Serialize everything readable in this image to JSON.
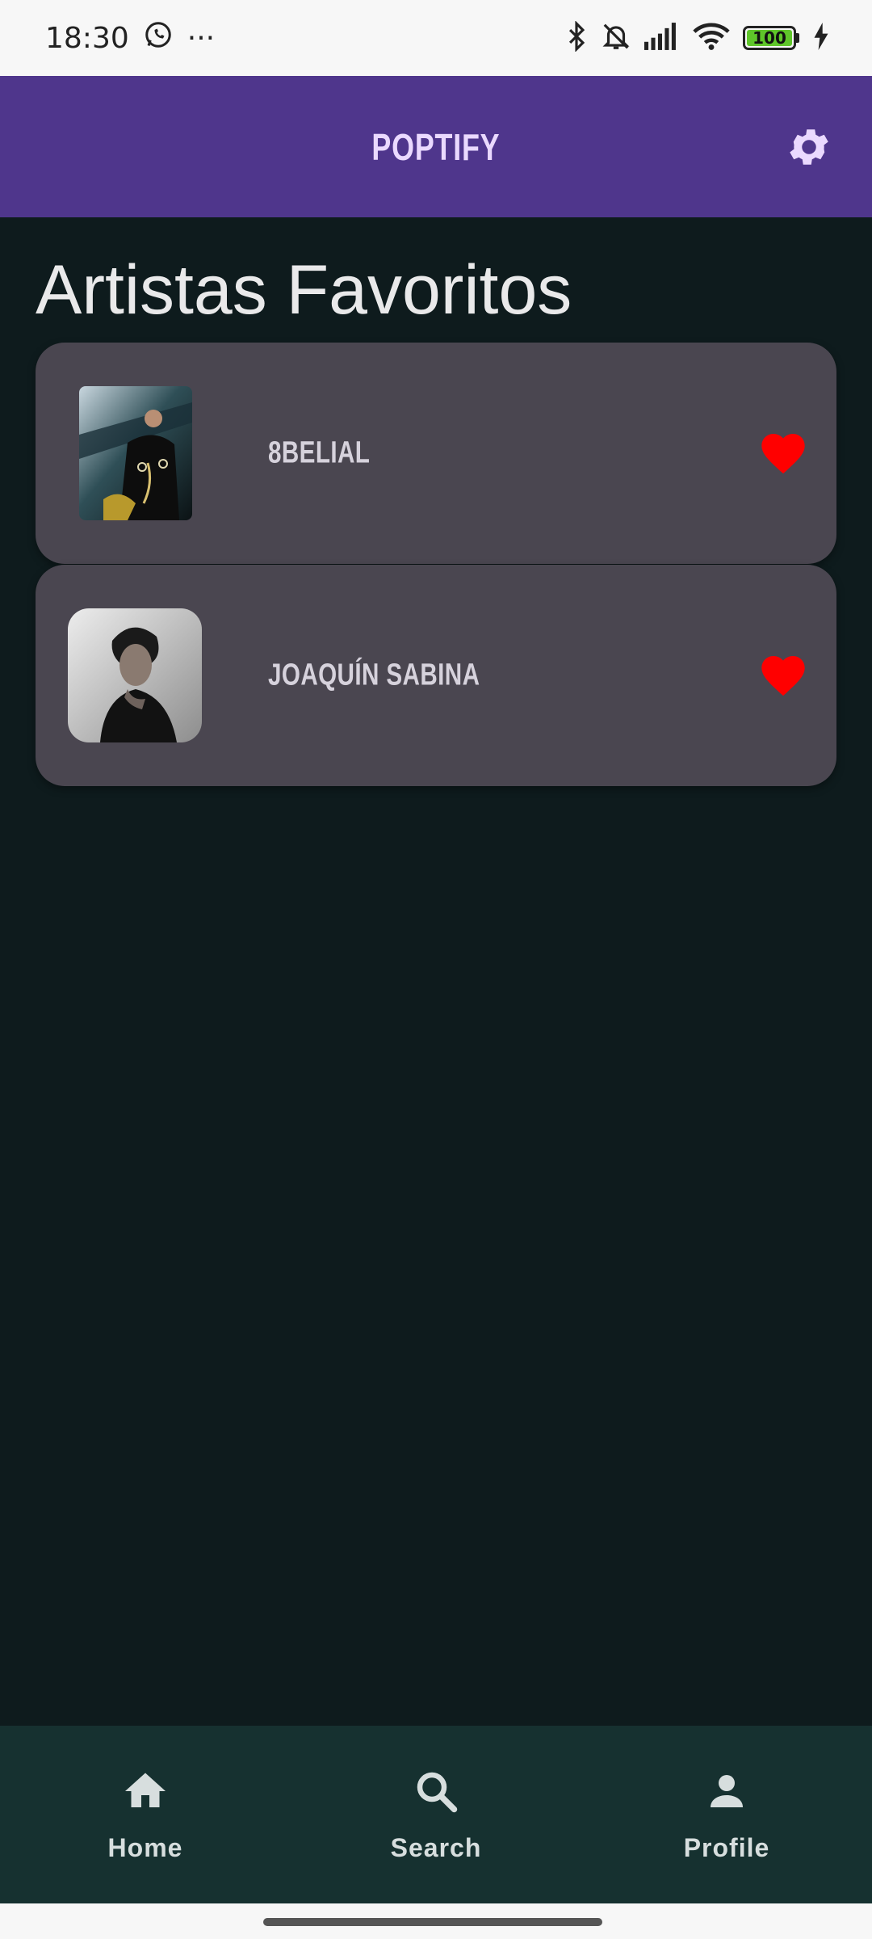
{
  "status_bar": {
    "time": "18:30",
    "more": "···",
    "battery_level": "100",
    "battery_fraction": 1.0
  },
  "app_bar": {
    "title": "POPTIFY"
  },
  "page": {
    "title": "Artistas Favoritos"
  },
  "favorites": [
    {
      "name": "8BELIAL",
      "favorite": true
    },
    {
      "name": "JOAQUÍN SABINA",
      "favorite": true
    }
  ],
  "nav": {
    "home": "Home",
    "search": "Search",
    "profile": "Profile"
  },
  "colors": {
    "app_bar": "#4f368c",
    "background": "#0e1b1d",
    "card": "#4a4650",
    "heart": "#ff0000",
    "bottom_nav": "#163130"
  },
  "icons": [
    "whatsapp-icon",
    "bluetooth-icon",
    "bell-off-icon",
    "signal-icon",
    "wifi-icon",
    "battery-icon",
    "charging-icon",
    "gear-icon",
    "heart-icon",
    "home-icon",
    "search-icon",
    "person-icon"
  ]
}
